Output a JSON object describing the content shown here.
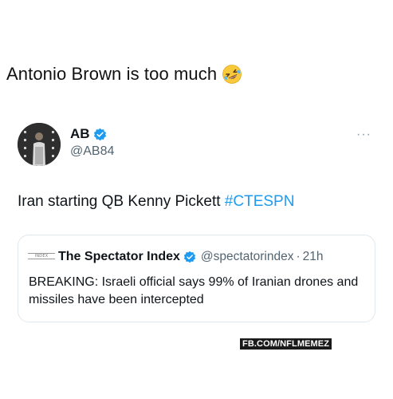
{
  "caption": {
    "text": "Antonio Brown is too much",
    "emoji_icon": "rolling-on-floor-laughing-icon"
  },
  "tweet": {
    "author_name": "AB",
    "author_handle": "@AB84",
    "body_text": "Iran starting QB Kenny Pickett ",
    "hashtag": "#CTESPN",
    "more_icon": "ellipsis-icon",
    "verified_icon": "verified-badge-icon"
  },
  "quoted_tweet": {
    "logo_text": "INDEX",
    "name": "The Spectator Index",
    "handle": "@spectatorindex",
    "separator": "·",
    "time": "21h",
    "text": "BREAKING: Israeli official says 99% of Iranian drones and missiles have been intercepted"
  },
  "watermark": {
    "text": "FB.COM/NFLMEMEZ"
  },
  "colors": {
    "link_blue": "#1d9bf0",
    "secondary_text": "#536471",
    "border": "#e1e8ed",
    "primary_text": "#0f1419"
  }
}
